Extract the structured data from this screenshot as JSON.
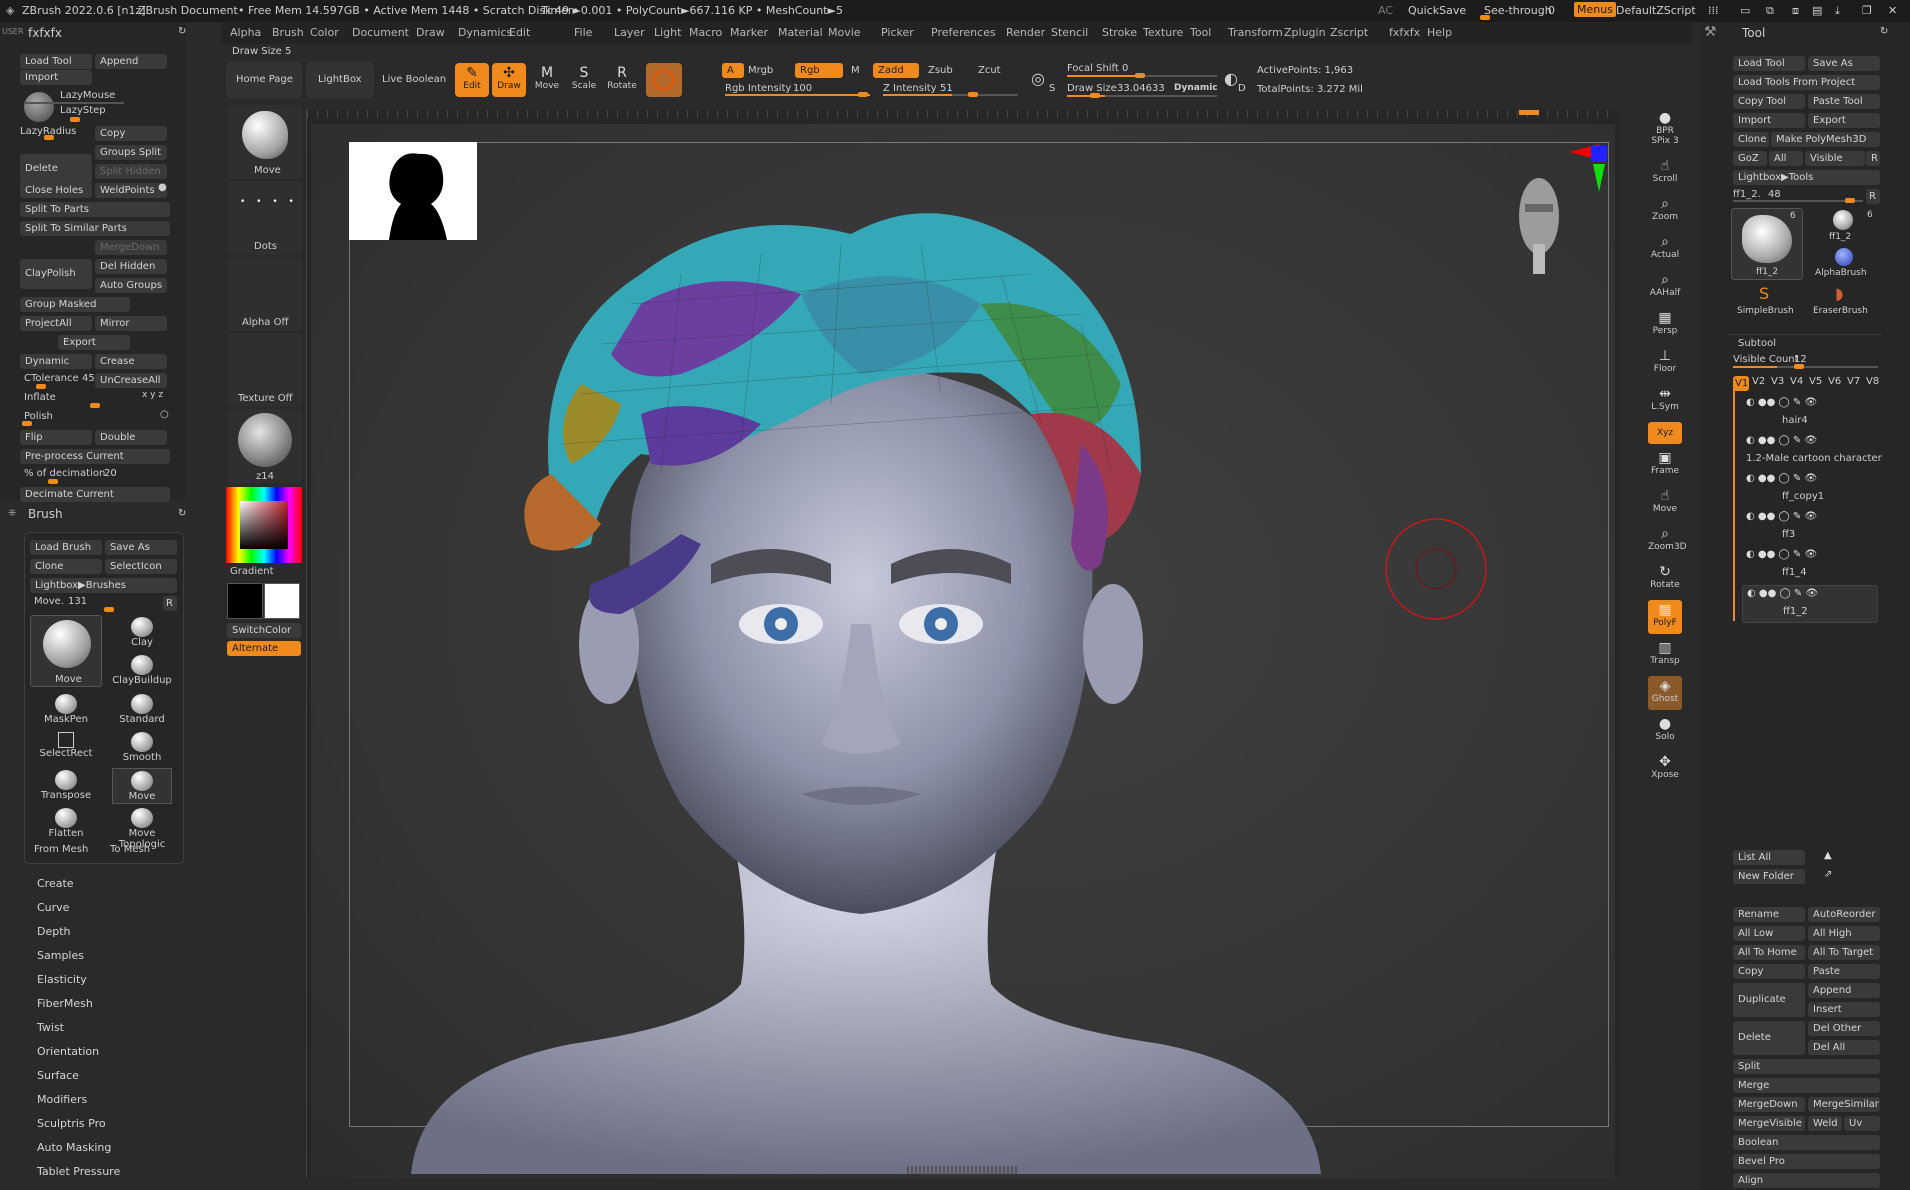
{
  "titlebar": {
    "app": "ZBrush 2022.0.6 [n1z]",
    "doc": "ZBrush Document",
    "mem": "• Free Mem 14.597GB • Active Mem 1448 • Scratch Disk 49 •",
    "timer": "Timer►0.001 • PolyCount►667.116 KP • MeshCount►5",
    "ac": "AC",
    "quicksave": "QuickSave",
    "seethrough": "See-through",
    "seethrough_value": "0",
    "menus": "Menus",
    "defaultzscript": "DefaultZScript"
  },
  "menubar": [
    "Alpha",
    "Brush",
    "Color",
    "Document",
    "Draw",
    "Dynamics",
    "Edit",
    "File",
    "Layer",
    "Light",
    "Macro",
    "Marker",
    "Material",
    "Movie",
    "Picker",
    "Preferences",
    "Render",
    "Stencil",
    "Stroke",
    "Texture",
    "Tool",
    "Transform",
    "Zplugin",
    "Zscript",
    "fxfxfx",
    "Help"
  ],
  "left": {
    "user": "USER",
    "title": "fxfxfx",
    "load_tool": "Load Tool",
    "append": "Append",
    "import": "Import",
    "lazymouse": "LazyMouse",
    "lazystep": "LazyStep",
    "lazyradius": "LazyRadius",
    "copy": "Copy",
    "delete": "Delete",
    "groups_split": "Groups Split",
    "split_hidden": "Split Hidden",
    "close_holes": "Close Holes",
    "weldpoints": "WeldPoints",
    "split_to_parts": "Split To Parts",
    "split_to_similar": "Split To Similar Parts",
    "claypolish": "ClayPolish",
    "mergedown": "MergeDown",
    "del_hidden": "Del Hidden",
    "auto_groups": "Auto Groups",
    "group_masked": "Group Masked",
    "projectall": "ProjectAll",
    "mirror": "Mirror",
    "export": "Export",
    "dynamic": "Dynamic",
    "crease": "Crease",
    "ctolerance": "CTolerance",
    "ctolerance_value": "45",
    "uncreaseall": "UnCreaseAll",
    "inflate": "Inflate",
    "inflate_axes": "x y z",
    "polish": "Polish",
    "flip": "Flip",
    "double": "Double",
    "preprocess": "Pre-process Current",
    "decimation": "% of decimation",
    "decimation_value": "20",
    "decimate_current": "Decimate Current"
  },
  "brush": {
    "title": "Brush",
    "load_brush": "Load Brush",
    "save_as": "Save As",
    "clone": "Clone",
    "selecticon": "SelectIcon",
    "lightbox": "Lightbox▶Brushes",
    "move_label": "Move.",
    "move_value": "131",
    "r": "R",
    "main": "Move",
    "cells": [
      "Clay",
      "ClayBuildup",
      "MaskPen",
      "Standard",
      "SelectRect",
      "Smooth",
      "Transpose",
      "Move",
      "Flatten",
      "Move Topologic"
    ],
    "from_mesh": "From Mesh",
    "to_mesh": "To Mesh"
  },
  "brush_menu": [
    "Create",
    "Curve",
    "Depth",
    "Samples",
    "Elasticity",
    "FiberMesh",
    "Twist",
    "Orientation",
    "Surface",
    "Modifiers",
    "Sculptris Pro",
    "Auto Masking",
    "Tablet Pressure"
  ],
  "shelf": {
    "draw_size_label": "Draw Size 5",
    "move": "Move",
    "dots": "Dots",
    "alpha_off": "Alpha Off",
    "texture_off": "Texture Off",
    "material": "z14",
    "gradient": "Gradient",
    "switchcolor": "SwitchColor",
    "alternate": "Alternate"
  },
  "toolbar": {
    "home_page": "Home Page",
    "lightbox": "LightBox",
    "live_boolean": "Live Boolean",
    "edit": "Edit",
    "draw": "Draw",
    "move": "Move",
    "scale": "Scale",
    "rotate": "Rotate",
    "a": "A",
    "mrgb": "Mrgb",
    "rgb": "Rgb",
    "m": "M",
    "zadd": "Zadd",
    "zsub": "Zsub",
    "zcut": "Zcut",
    "rgb_intensity": "Rgb Intensity",
    "rgb_intensity_value": "100",
    "z_intensity": "Z Intensity",
    "z_intensity_value": "51",
    "focal_shift": "Focal Shift",
    "focal_shift_value": "0",
    "draw_size": "Draw Size",
    "draw_size_value": "33.04633",
    "dynamic": "Dynamic",
    "s": "S",
    "d": "D",
    "active_points": "ActivePoints: 1,963",
    "total_points": "TotalPoints: 3.272 Mil"
  },
  "rightshelf": [
    {
      "label": "BPR",
      "sub": "SPix 3"
    },
    {
      "label": "Scroll"
    },
    {
      "label": "Zoom"
    },
    {
      "label": "Actual"
    },
    {
      "label": "AAHalf"
    },
    {
      "label": "Persp"
    },
    {
      "label": "Floor"
    },
    {
      "label": "L.Sym"
    },
    {
      "label": "Xyz"
    },
    {
      "label": "Frame"
    },
    {
      "label": "Move"
    },
    {
      "label": "Zoom3D"
    },
    {
      "label": "Rotate"
    },
    {
      "label": "PolyF"
    },
    {
      "label": "Transp"
    },
    {
      "label": "Ghost"
    },
    {
      "label": "Solo"
    },
    {
      "label": "Xpose"
    }
  ],
  "tool": {
    "title": "Tool",
    "load_tool": "Load Tool",
    "save_as": "Save As",
    "load_from_project": "Load Tools From Project",
    "copy_tool": "Copy Tool",
    "paste_tool": "Paste Tool",
    "import": "Import",
    "export": "Export",
    "clone": "Clone",
    "make_polymesh": "Make PolyMesh3D",
    "goz": "GoZ",
    "all": "All",
    "visible": "Visible",
    "r": "R",
    "lightbox_tools": "Lightbox▶Tools",
    "current_tool": "ff1_2.",
    "current_value": "48",
    "thumbs": [
      {
        "name": "ff1_2",
        "count": "6"
      },
      {
        "name": "ff1_2",
        "count": "6"
      },
      {
        "name": "AlphaBrush"
      },
      {
        "name": "SimpleBrush"
      },
      {
        "name": "EraserBrush"
      }
    ]
  },
  "subtool": {
    "title": "Subtool",
    "visible_count": "Visible Count",
    "visible_count_value": "12",
    "versions": [
      "V1",
      "V2",
      "V3",
      "V4",
      "V5",
      "V6",
      "V7",
      "V8"
    ],
    "items": [
      "hair4",
      "1.2-Male cartoon character",
      "ff_copy1",
      "ff3",
      "ff1_4",
      "ff1_2"
    ],
    "list_all": "List All",
    "new_folder": "New Folder",
    "rename": "Rename",
    "autoreorder": "AutoReorder",
    "all_low": "All Low",
    "all_high": "All High",
    "all_to_home": "All To Home",
    "all_to_target": "All To Target",
    "copy": "Copy",
    "paste": "Paste",
    "duplicate": "Duplicate",
    "append": "Append",
    "insert": "Insert",
    "delete": "Delete",
    "del_other": "Del Other",
    "del_all": "Del All",
    "split": "Split",
    "merge": "Merge",
    "mergedown": "MergeDown",
    "mergesimilar": "MergeSimilar",
    "mergevisible": "MergeVisible",
    "weld": "Weld",
    "uv": "Uv",
    "boolean": "Boolean",
    "bevel_pro": "Bevel Pro",
    "align": "Align"
  },
  "colors": {
    "accent": "#f08a1c",
    "panel": "#2a2a2a",
    "button": "#3a3a3a",
    "canvas": "#393939"
  }
}
